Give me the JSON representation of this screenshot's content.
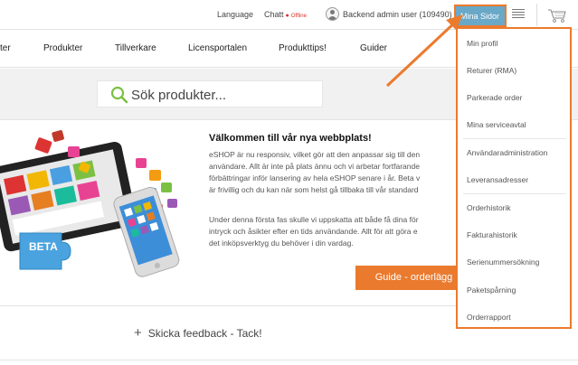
{
  "topbar": {
    "language": "Language",
    "chat": "Chatt",
    "chat_status": "Offline",
    "admin_user": "Backend admin user (109490)",
    "my_pages": "Mina Sidor"
  },
  "nav": {
    "items": [
      "ter",
      "Produkter",
      "Tillverkare",
      "Licensportalen",
      "Produkttips!",
      "Guider"
    ]
  },
  "search": {
    "placeholder": "Sök produkter..."
  },
  "hero": {
    "title": "Välkommen till vår nya webbplats!",
    "paragraph1": [
      "eSHOP är nu responsiv, vilket gör att den anpassar sig till den",
      "användare. Allt är inte på plats ännu och vi arbetar fortfarande",
      "förbättringar inför lansering av hela eSHOP senare i år. Beta v",
      "är frivillig och du kan när som helst gå tillbaka till vår standard"
    ],
    "paragraph2": [
      "Under denna första fas skulle vi uppskatta att både få dina för",
      "intryck och åsikter efter en tids användande. Allt för att göra e",
      "det inköpsverktyg du behöver i din vardag."
    ],
    "guide_button": "Guide - orderlägg",
    "beta_badge": "BETA"
  },
  "feedback": {
    "plus": "+",
    "label": "Skicka feedback - Tack!"
  },
  "dropdown": {
    "items": [
      "Min profil",
      "Returer (RMA)",
      "Parkerade order",
      "Mina serviceavtal",
      "Användaradministration",
      "Leveransadresser",
      "Orderhistorik",
      "Fakturahistorik",
      "Serienummersökning",
      "Paketspårning",
      "Orderrapport"
    ]
  },
  "colors": {
    "accent_orange": "#ea7a2e",
    "my_pages_bg": "#6aa8c7",
    "offline_red": "#d9342b",
    "search_green": "#7cc043"
  }
}
